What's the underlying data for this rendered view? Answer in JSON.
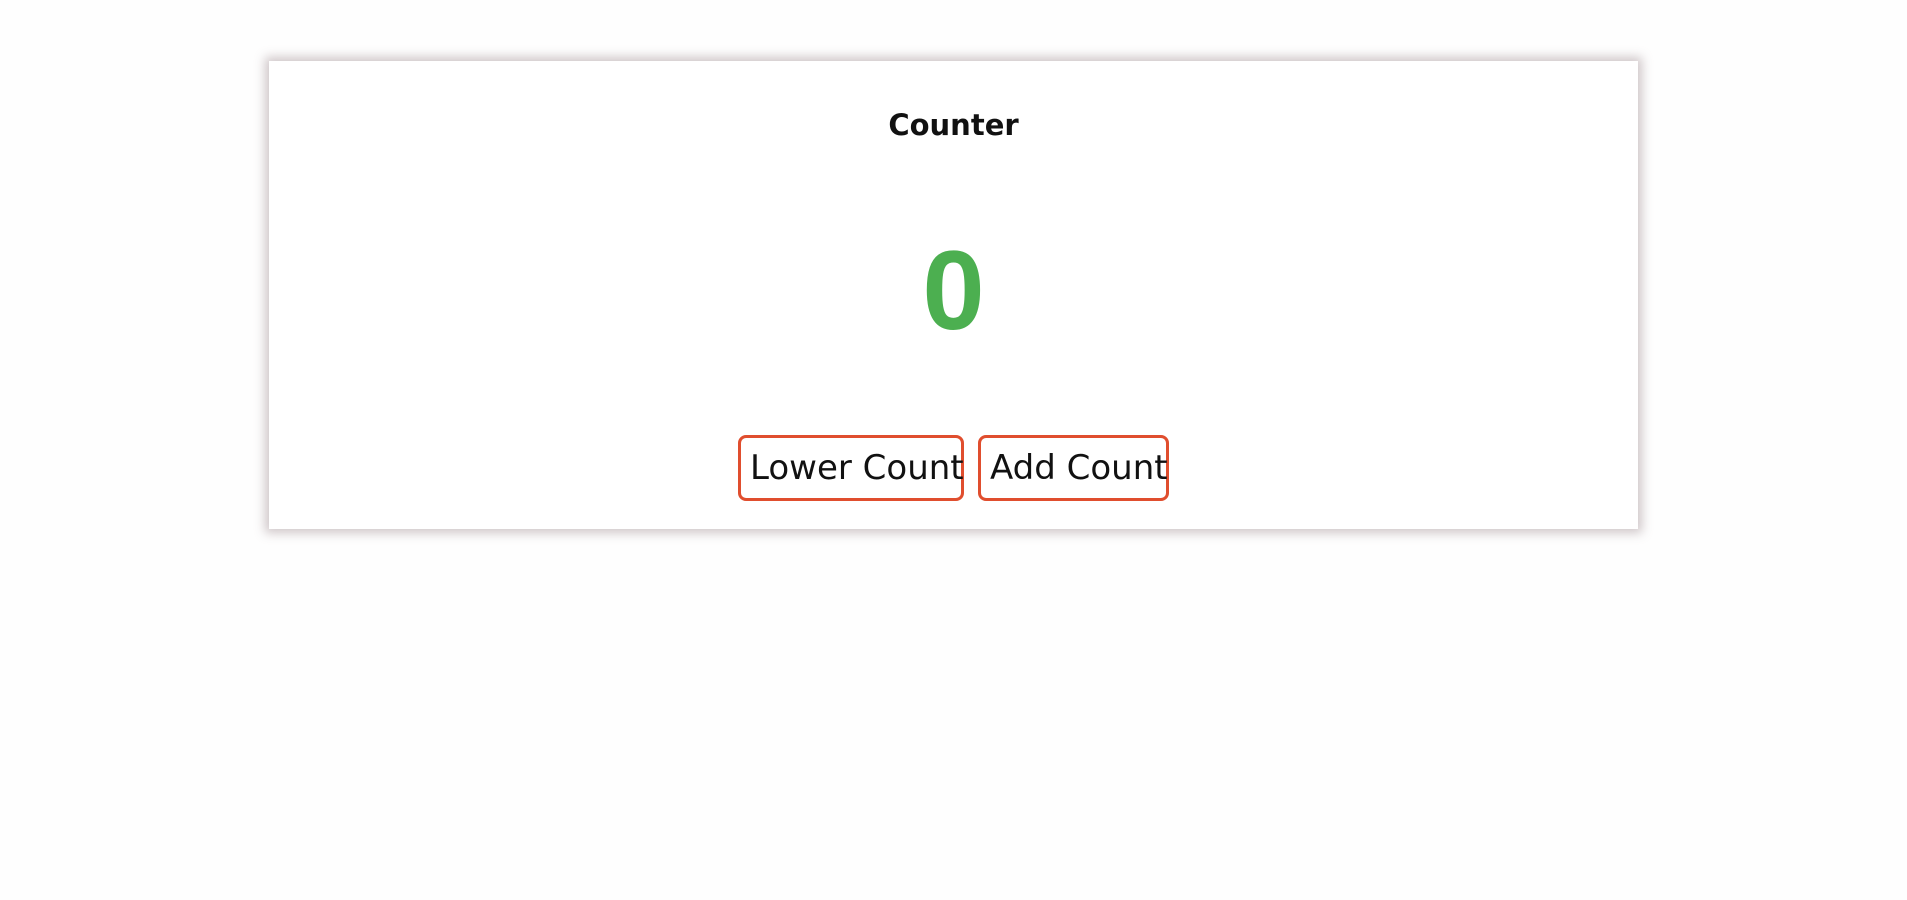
{
  "counter": {
    "title": "Counter",
    "value": "0",
    "value_color": "#4caf50",
    "lower_label": "Lower Count",
    "add_label": "Add Count",
    "button_border_color": "#e04e2e"
  }
}
